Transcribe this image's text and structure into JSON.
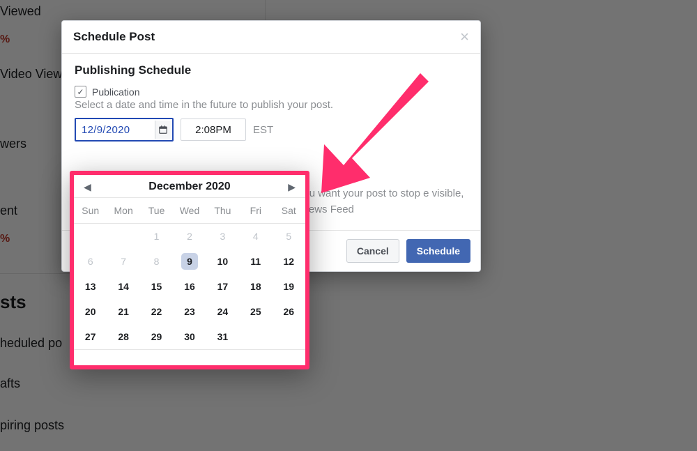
{
  "background": {
    "viewed": "Viewed",
    "pct1": "%",
    "video_views": "Video Views",
    "wers": "wers",
    "ent": "ent",
    "pct2": "%",
    "sts": "sts",
    "sched": "heduled po",
    "drafts": "afts",
    "expiring": "piring posts"
  },
  "modal": {
    "title": "Schedule Post",
    "section_title": "Publishing Schedule",
    "checkbox_label": "Publication",
    "checkbox_checked": "✓",
    "helper": "Select a date and time in the future to publish your post.",
    "date_value": "12/9/2020",
    "time_value": "2:08PM",
    "tz": "EST",
    "stop_text": "en you want your post to stop e visible, but News Feed",
    "cancel": "Cancel",
    "schedule": "Schedule"
  },
  "calendar": {
    "title": "December 2020",
    "dow": [
      "Sun",
      "Mon",
      "Tue",
      "Wed",
      "Thu",
      "Fri",
      "Sat"
    ],
    "weeks": [
      [
        {
          "n": "",
          "dim": true
        },
        {
          "n": "",
          "dim": true
        },
        {
          "n": "1",
          "dim": true
        },
        {
          "n": "2",
          "dim": true
        },
        {
          "n": "3",
          "dim": true
        },
        {
          "n": "4",
          "dim": true
        },
        {
          "n": "5",
          "dim": true
        }
      ],
      [
        {
          "n": "6",
          "dim": true
        },
        {
          "n": "7",
          "dim": true
        },
        {
          "n": "8",
          "dim": true
        },
        {
          "n": "9",
          "sel": true
        },
        {
          "n": "10"
        },
        {
          "n": "11"
        },
        {
          "n": "12"
        }
      ],
      [
        {
          "n": "13"
        },
        {
          "n": "14"
        },
        {
          "n": "15"
        },
        {
          "n": "16"
        },
        {
          "n": "17"
        },
        {
          "n": "18"
        },
        {
          "n": "19"
        }
      ],
      [
        {
          "n": "20"
        },
        {
          "n": "21"
        },
        {
          "n": "22"
        },
        {
          "n": "23"
        },
        {
          "n": "24"
        },
        {
          "n": "25"
        },
        {
          "n": "26"
        }
      ],
      [
        {
          "n": "27"
        },
        {
          "n": "28"
        },
        {
          "n": "29"
        },
        {
          "n": "30"
        },
        {
          "n": "31"
        },
        {
          "n": ""
        },
        {
          "n": ""
        }
      ]
    ]
  },
  "colors": {
    "accent": "#ff2d6c",
    "primary": "#4267b2",
    "link": "#2249b3"
  }
}
